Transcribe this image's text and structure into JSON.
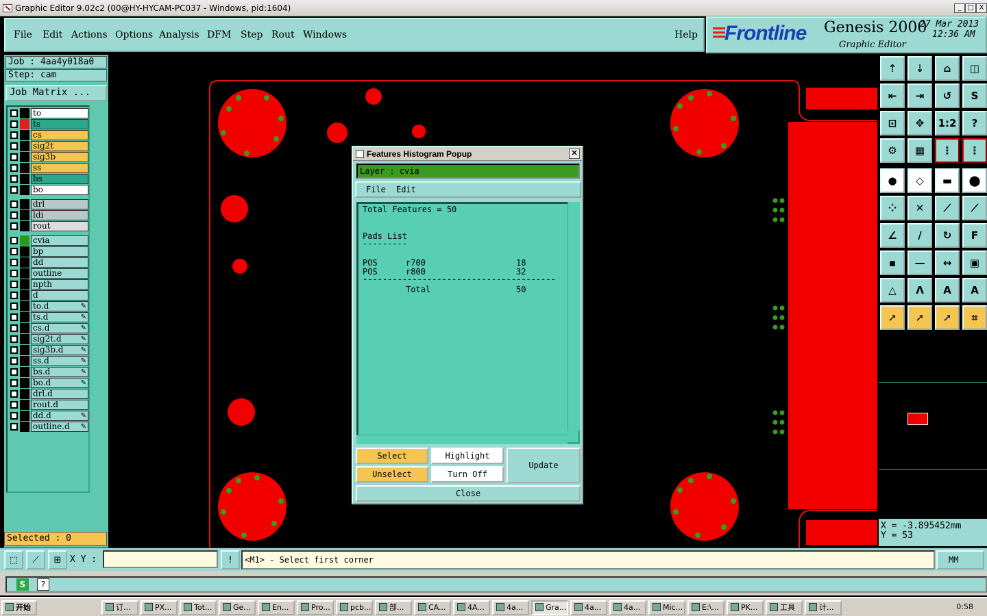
{
  "window": {
    "title": "Graphic Editor 9.02c2 (00@HY-HYCAM-PC037 - Windows, pid:1604)",
    "controls": [
      "_",
      "□",
      "X"
    ]
  },
  "menu": {
    "items": [
      "File",
      "Edit",
      "Actions",
      "Options",
      "Analysis",
      "DFM",
      "Step",
      "Rout",
      "Windows"
    ],
    "help": "Help"
  },
  "header": {
    "brand": "Frontline",
    "product": "Genesis 2000",
    "subtitle": "Graphic Editor",
    "date": "27 Mar 2013",
    "time": "12:36 AM"
  },
  "left": {
    "job": "Job  :  4aa4y018a0",
    "step": "Step:  cam",
    "job_matrix": "Job Matrix ...",
    "selected": "Selected :  0"
  },
  "layers": [
    {
      "name": "to",
      "color": "#ffffff",
      "swatch": "#000000",
      "editable": false
    },
    {
      "name": "ts",
      "color": "#2ea88c",
      "swatch": "#e02020",
      "editable": false
    },
    {
      "name": "cs",
      "color": "#f5c552",
      "swatch": "#000000",
      "editable": false
    },
    {
      "name": "sig2t",
      "color": "#f5c552",
      "swatch": "#000000",
      "editable": false
    },
    {
      "name": "sig3b",
      "color": "#f5c552",
      "swatch": "#000000",
      "editable": false
    },
    {
      "name": "ss",
      "color": "#f5c552",
      "swatch": "#000000",
      "editable": false
    },
    {
      "name": "bs",
      "color": "#2ea88c",
      "swatch": "#000000",
      "editable": false
    },
    {
      "name": "bo",
      "color": "#ffffff",
      "swatch": "#000000",
      "editable": false
    },
    {
      "name": "drl",
      "color": "#b8c8c8",
      "swatch": "#000000",
      "editable": false
    },
    {
      "name": "ldi",
      "color": "#b8c8c8",
      "swatch": "#000000",
      "editable": false
    },
    {
      "name": "rout",
      "color": "#dcdcdc",
      "swatch": "#000000",
      "editable": false
    },
    {
      "name": "cvia",
      "color": "#9bd9d2",
      "swatch": "#2a9a1e",
      "editable": false
    },
    {
      "name": "bp",
      "color": "#9bd9d2",
      "swatch": "#000000",
      "editable": false
    },
    {
      "name": "dd",
      "color": "#9bd9d2",
      "swatch": "#000000",
      "editable": false
    },
    {
      "name": "outline",
      "color": "#9bd9d2",
      "swatch": "#000000",
      "editable": false
    },
    {
      "name": "npth",
      "color": "#9bd9d2",
      "swatch": "#000000",
      "editable": false
    },
    {
      "name": "d",
      "color": "#9bd9d2",
      "swatch": "#000000",
      "editable": false
    },
    {
      "name": "to.d",
      "color": "#9bd9d2",
      "swatch": "#000000",
      "editable": true
    },
    {
      "name": "ts.d",
      "color": "#9bd9d2",
      "swatch": "#000000",
      "editable": true
    },
    {
      "name": "cs.d",
      "color": "#9bd9d2",
      "swatch": "#000000",
      "editable": true
    },
    {
      "name": "sig2t.d",
      "color": "#9bd9d2",
      "swatch": "#000000",
      "editable": true
    },
    {
      "name": "sig3b.d",
      "color": "#9bd9d2",
      "swatch": "#000000",
      "editable": true
    },
    {
      "name": "ss.d",
      "color": "#9bd9d2",
      "swatch": "#000000",
      "editable": true
    },
    {
      "name": "bs.d",
      "color": "#9bd9d2",
      "swatch": "#000000",
      "editable": true
    },
    {
      "name": "bo.d",
      "color": "#9bd9d2",
      "swatch": "#000000",
      "editable": true
    },
    {
      "name": "drl.d",
      "color": "#9bd9d2",
      "swatch": "#000000",
      "editable": false
    },
    {
      "name": "rout.d",
      "color": "#9bd9d2",
      "swatch": "#000000",
      "editable": false
    },
    {
      "name": "dd.d",
      "color": "#9bd9d2",
      "swatch": "#000000",
      "editable": true
    },
    {
      "name": "outline.d",
      "color": "#9bd9d2",
      "swatch": "#000000",
      "editable": true
    }
  ],
  "popup": {
    "title": "Features Histogram Popup",
    "layer": "Layer :  cvia",
    "menu": [
      "File",
      "Edit"
    ],
    "total_features": "Total Features = 50",
    "pads_title": "Pads List",
    "underline": "---------",
    "rows": [
      {
        "type": "POS",
        "symbol": "r700",
        "count": "18"
      },
      {
        "type": "POS",
        "symbol": "r800",
        "count": "32"
      }
    ],
    "separator": "---------------------------------------",
    "total_label": "Total",
    "total_value": "50",
    "buttons": {
      "select": "Select",
      "highlight": "Highlight",
      "update": "Update",
      "unselect": "Unselect",
      "turn_off": "Turn Off",
      "close": "Close"
    }
  },
  "status": {
    "xy_label": "X Y :",
    "xy_value": "",
    "prompt": "<M1> - Select first corner",
    "units": "MM",
    "x": "X  =  -3.895452mm",
    "y": "Y  =  53"
  },
  "taskbar": {
    "start": "开始",
    "items": [
      "订...",
      "PX...",
      "Tot...",
      "Ge...",
      "En...",
      "Pro...",
      "pcb...",
      "部...",
      "CA...",
      "4A...",
      "4a...",
      "Gra...",
      "4a...",
      "4a...",
      "Mic...",
      "E:\\...",
      "PK...",
      "工具",
      "计..."
    ],
    "clock": "0:58"
  },
  "icons": [
    "app-icon",
    "s-icon",
    "help-icon"
  ]
}
